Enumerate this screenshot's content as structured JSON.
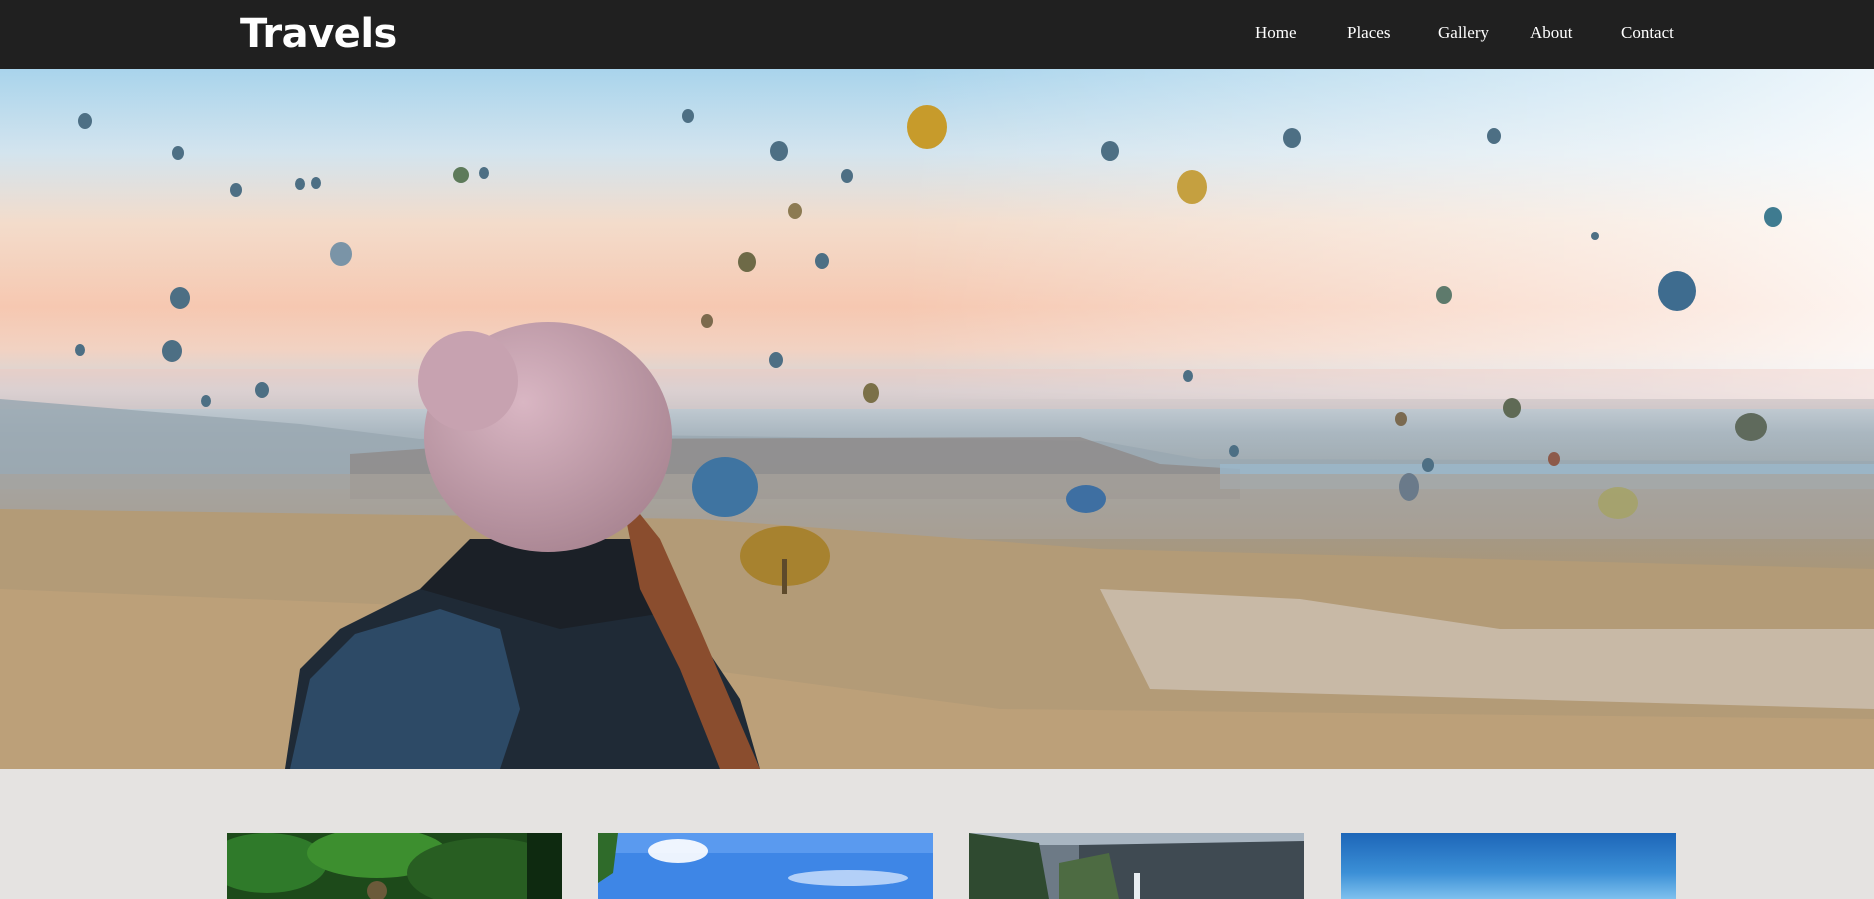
{
  "navbar": {
    "brand": "Travels",
    "links": [
      {
        "label": "Home"
      },
      {
        "label": "Places"
      },
      {
        "label": "Gallery"
      },
      {
        "label": "About"
      },
      {
        "label": "Contact"
      }
    ]
  },
  "hero": {
    "image": "hot-air-balloons-hiker-photo"
  },
  "cards": [
    {
      "image": "jungle-photo"
    },
    {
      "image": "blue-sky-palm-photo"
    },
    {
      "image": "waterfall-cliff-photo"
    },
    {
      "image": "ocean-horizon-photo"
    }
  ],
  "colors": {
    "navbar_bg": "#202020",
    "nav_text": "#ffffff",
    "page_bg": "#e5e3e1"
  }
}
